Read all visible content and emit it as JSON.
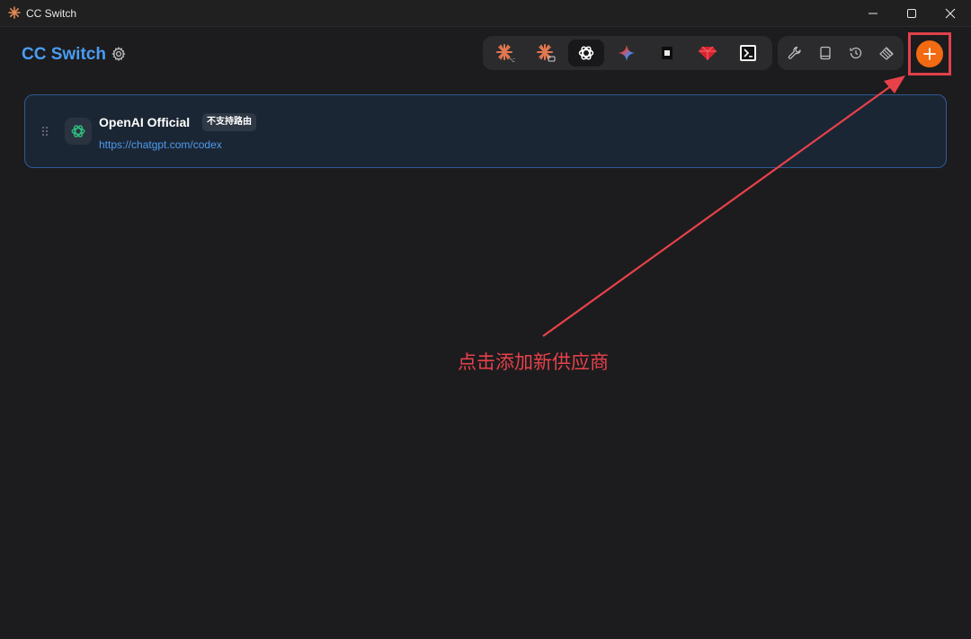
{
  "window": {
    "title": "CC Switch"
  },
  "header": {
    "brand": "CC Switch"
  },
  "apps": [
    {
      "name": "claude-code-icon"
    },
    {
      "name": "claude-desktop-icon"
    },
    {
      "name": "openai-codex-icon",
      "active": true
    },
    {
      "name": "gemini-icon"
    },
    {
      "name": "opencode-icon"
    },
    {
      "name": "ruby-gem-icon"
    },
    {
      "name": "terminal-app-icon"
    }
  ],
  "tools": [
    "wrench-icon",
    "book-icon",
    "history-icon",
    "layers-icon"
  ],
  "provider": {
    "name": "OpenAI Official",
    "badge": "不支持路由",
    "url": "https://chatgpt.com/codex"
  },
  "annotation": {
    "text": "点击添加新供应商"
  },
  "colors": {
    "accent": "#4a9cf2",
    "add": "#f26a12",
    "annotation": "#e8414a"
  }
}
